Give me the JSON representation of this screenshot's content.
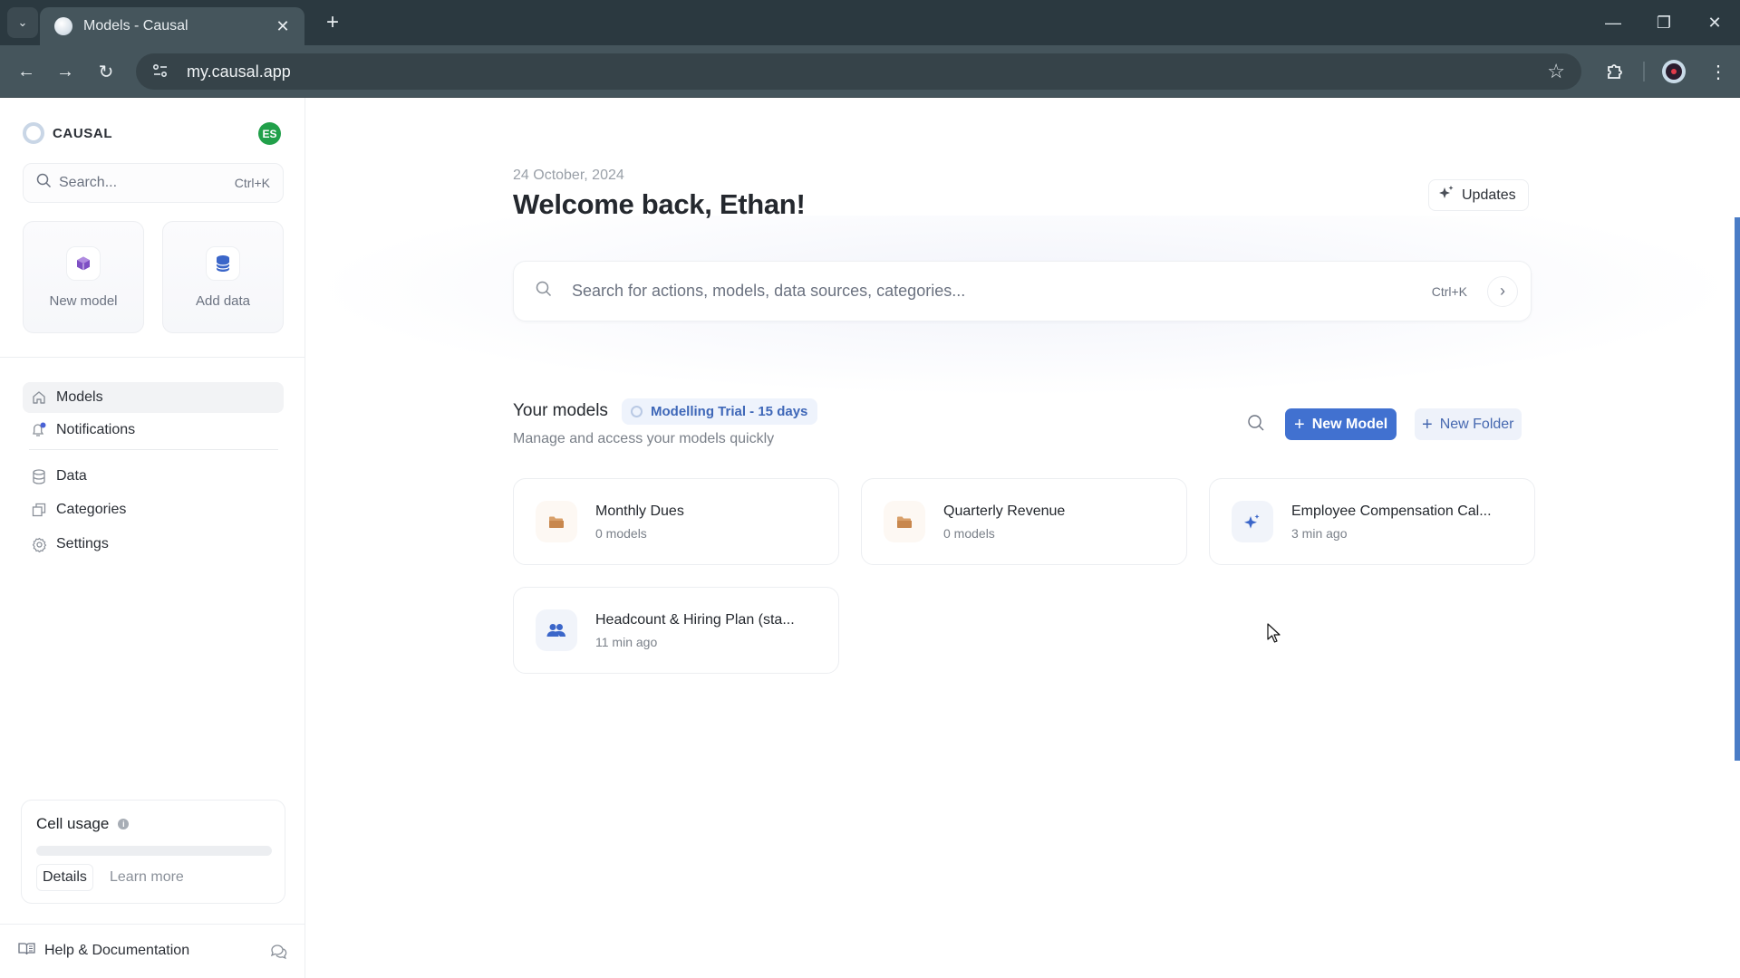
{
  "browser": {
    "tab_title": "Models - Causal",
    "url": "my.causal.app",
    "icons": {
      "tab_list": "chevron-down-icon",
      "close_tab": "close-icon",
      "new_tab": "plus-icon",
      "back": "arrow-left-icon",
      "forward": "arrow-right-icon",
      "reload": "reload-icon",
      "site_info": "tune-icon",
      "bookmark": "star-icon",
      "extensions": "puzzle-icon",
      "profile": "profile-icon",
      "menu": "more-vertical-icon",
      "minimize": "minimize-icon",
      "restore": "restore-icon",
      "close_window": "close-icon"
    }
  },
  "sidebar": {
    "brand": "CAUSAL",
    "avatar_initials": "ES",
    "avatar_color": "#21a04a",
    "search": {
      "placeholder": "Search...",
      "shortcut": "Ctrl+K"
    },
    "quick_actions": [
      {
        "label": "New model",
        "icon": "cube-icon",
        "color": "#7e4fc4"
      },
      {
        "label": "Add data",
        "icon": "database-icon",
        "color": "#3b66c9"
      }
    ],
    "nav": [
      {
        "label": "Models",
        "icon": "home-icon",
        "active": true
      },
      {
        "label": "Notifications",
        "icon": "bell-icon",
        "badge_dot": true
      },
      {
        "label": "Data",
        "icon": "database-icon"
      },
      {
        "label": "Categories",
        "icon": "copy-icon"
      },
      {
        "label": "Settings",
        "icon": "gear-icon"
      }
    ],
    "usage": {
      "title": "Cell usage",
      "progress_percent": 0,
      "details_label": "Details",
      "learn_more_label": "Learn more"
    },
    "footer": {
      "help_label": "Help & Documentation",
      "help_icon": "book-icon",
      "chat_icon": "chat-icon"
    }
  },
  "main": {
    "date": "24 October, 2024",
    "welcome": "Welcome back, Ethan!",
    "updates_label": "Updates",
    "search": {
      "placeholder": "Search for actions, models, data sources, categories...",
      "shortcut": "Ctrl+K"
    },
    "models_section": {
      "title": "Your models",
      "trial_badge": "Modelling Trial - 15 days",
      "subtitle": "Manage and access your models quickly",
      "new_model_label": "New Model",
      "new_folder_label": "New Folder",
      "accent_color": "#4171d0"
    },
    "items": [
      {
        "name": "Monthly Dues",
        "meta": "0 models",
        "type": "folder",
        "icon": "folder-icon"
      },
      {
        "name": "Quarterly Revenue",
        "meta": "0 models",
        "type": "folder",
        "icon": "folder-icon"
      },
      {
        "name": "Employee Compensation Cal...",
        "meta": "3 min ago",
        "type": "model",
        "icon": "sparkle-icon"
      },
      {
        "name": "Headcount & Hiring Plan (sta...",
        "meta": "11 min ago",
        "type": "model",
        "icon": "users-icon"
      }
    ]
  }
}
